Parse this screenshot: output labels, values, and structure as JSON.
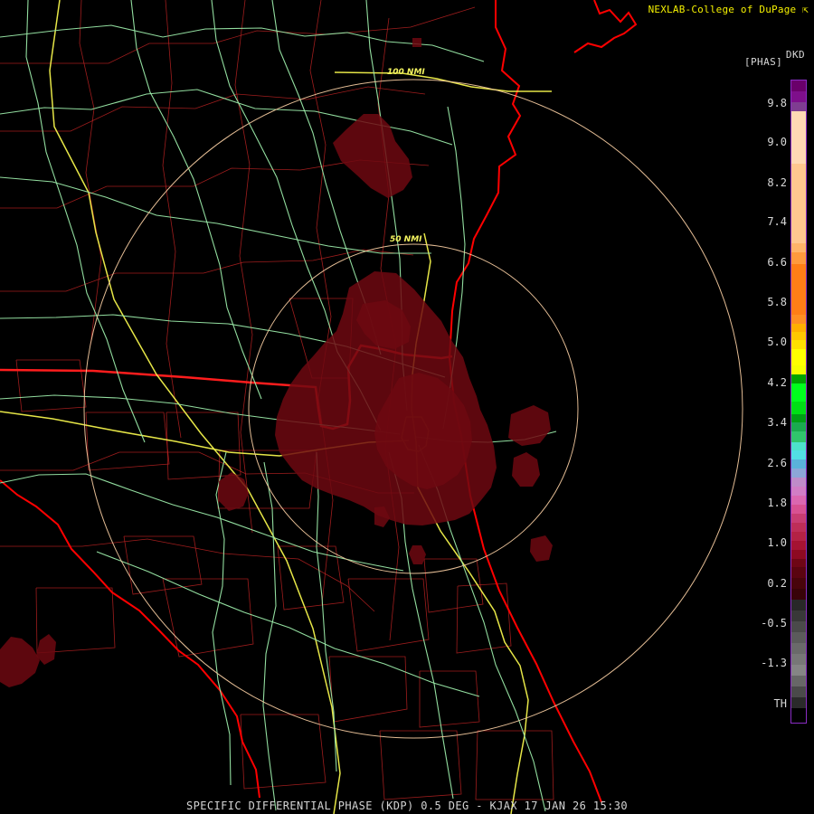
{
  "header": {
    "credit": "NEXLAB-College of DuPage",
    "product_code": "DKD",
    "units": "[PHAS]"
  },
  "footer": {
    "caption": "SPECIFIC DIFFERENTIAL PHASE (KDP) 0.5 DEG - KJAX 17 JAN 26 15:30"
  },
  "range_rings": [
    {
      "label": "100 NMI"
    },
    {
      "label": "50 NMI"
    }
  ],
  "legend": {
    "ticks": [
      "9.8",
      "9.0",
      "8.2",
      "7.4",
      "6.6",
      "5.8",
      "5.0",
      "4.2",
      "3.4",
      "2.6",
      "1.8",
      "1.0",
      "0.2",
      "-0.5",
      "-1.3",
      "TH"
    ]
  },
  "colors": {
    "background": "#000000",
    "boundary": "#ff1d1d",
    "roads_primary": "#f2f24b",
    "roads_secondary": "#9ae9a8",
    "rings": "#efc69c",
    "echo": "#6d0810"
  }
}
